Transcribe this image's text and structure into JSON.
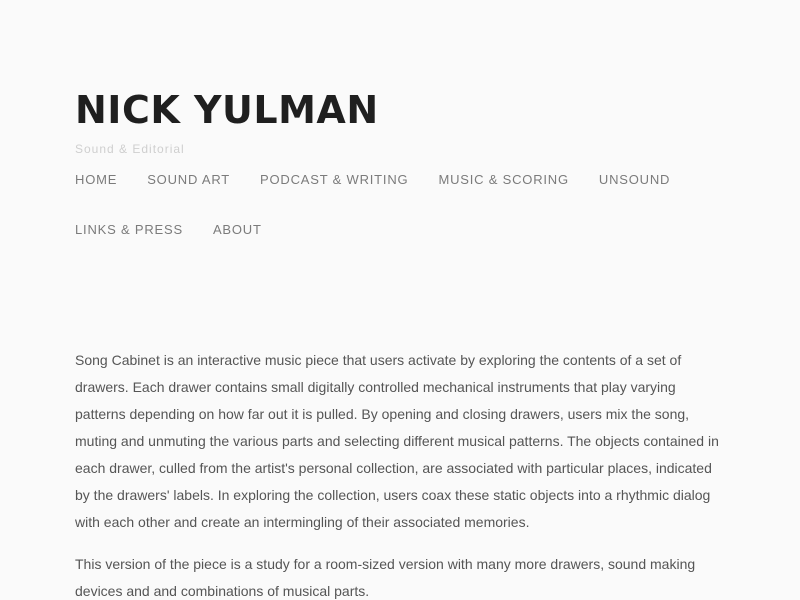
{
  "site": {
    "title": "NICK YULMAN",
    "tagline": "Sound & Editorial"
  },
  "nav": {
    "items": [
      {
        "label": "HOME"
      },
      {
        "label": "SOUND ART"
      },
      {
        "label": "PODCAST & WRITING"
      },
      {
        "label": "MUSIC & SCORING"
      },
      {
        "label": "UNSOUND"
      },
      {
        "label": "LINKS & PRESS"
      },
      {
        "label": "ABOUT"
      }
    ]
  },
  "content": {
    "paragraphs": [
      " Song Cabinet is an interactive music piece that users activate by exploring the contents of a set of drawers.  Each drawer contains small digitally controlled mechanical instruments that play varying patterns depending on how far out it is pulled.  By opening and closing drawers, users mix the song, muting and unmuting the various parts and selecting different musical patterns.  The objects contained in each drawer, culled from the artist's personal collection, are associated with particular places, indicated by the drawers' labels.  In exploring the collection, users coax these static objects into a rhythmic dialog with each other and create an intermingling of their associated memories.",
      "This version of the piece is a study for a room-sized version with many more drawers, sound making devices and  and combinations of musical parts."
    ]
  },
  "colors": {
    "background": "#fafafa",
    "title": "#1f1f1f",
    "tagline": "#cfcfcf",
    "nav": "#7b7b7b",
    "body_text": "#555555"
  }
}
